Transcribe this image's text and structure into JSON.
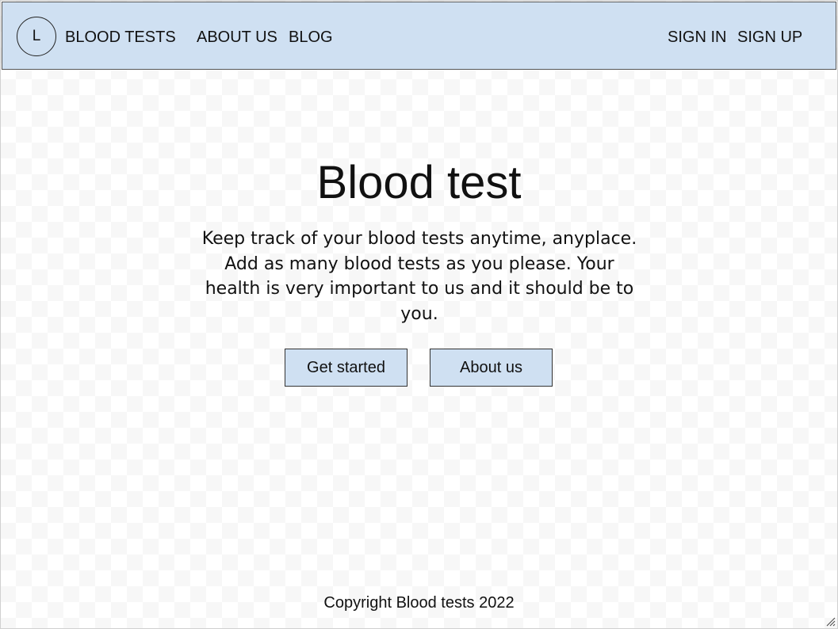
{
  "navbar": {
    "logo_letter": "L",
    "brand": "BLOOD TESTS",
    "links": [
      "ABOUT US",
      "BLOG"
    ],
    "auth": {
      "sign_in": "SIGN IN",
      "sign_up": "SIGN UP"
    }
  },
  "hero": {
    "title": "Blood test",
    "description": "Keep track of your blood tests anytime, anyplace. Add as many blood tests as you please. Your health is very important to us and it should be to you.",
    "buttons": {
      "get_started": "Get started",
      "about_us": "About us"
    }
  },
  "footer": {
    "copyright": "Copyright Blood tests 2022"
  },
  "colors": {
    "nav_background": "#cfe0f2",
    "button_background": "#cfe0f2",
    "text": "#111111"
  },
  "icons": {
    "resize_grip": "resize-grip-icon"
  }
}
